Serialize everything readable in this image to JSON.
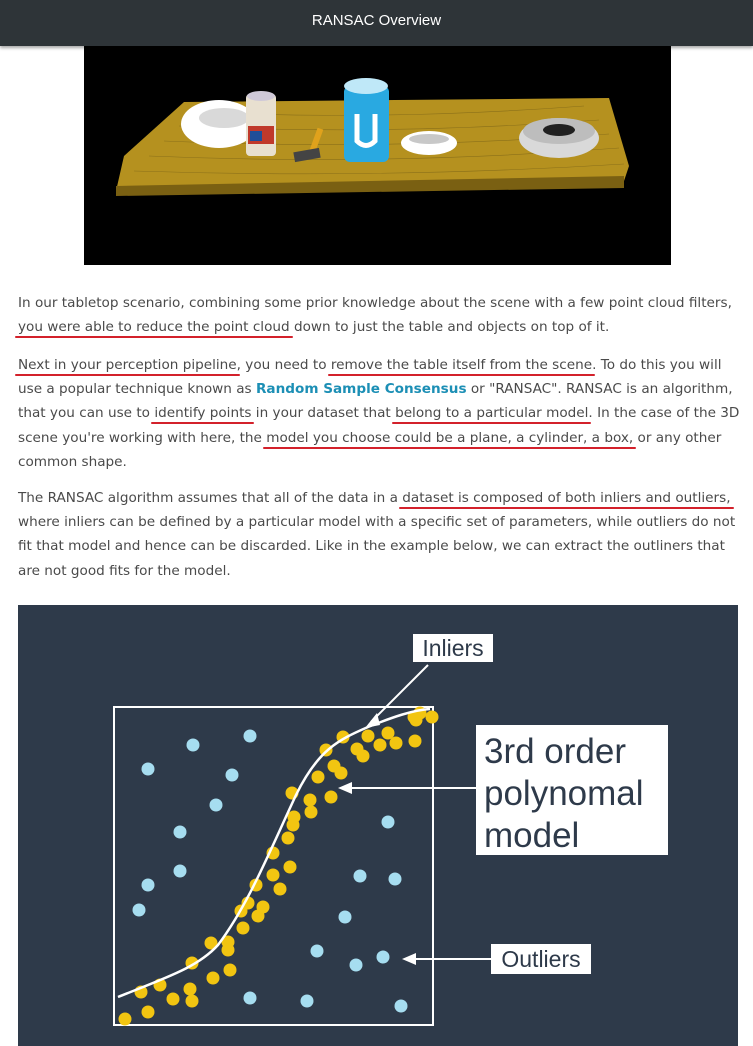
{
  "header": {
    "title": "RANSAC Overview"
  },
  "p1": {
    "a": "In our tabletop scenario, combining some prior knowledge about the scene with a few point cloud filters, ",
    "b": "you were able to reduce the point cloud",
    "c": " down to just the table and objects on top of it."
  },
  "p2": {
    "a": "Next in your perception pipeline",
    "b": ", you need to ",
    "c": "remove the table itself from the scene",
    "d": ". To do this you will use a popular technique known as ",
    "link": "Random Sample Consensus",
    "e": " or \"RANSAC\". RANSAC is an algorithm, that you can use to ",
    "f": "identify points",
    "g": " in your dataset that ",
    "h": "belong to a particular model",
    "i": ". In the case of the 3D scene you're working with here, the ",
    "j": "model you choose could be a plane, a cylinder, a box,",
    "k": " or any other common shape."
  },
  "p3": {
    "a": "The RANSAC algorithm assumes that all of the data in a ",
    "b": "dataset is composed of both inliers and outliers,",
    "c": " where inliers can be defined by a particular model with a specific set of parameters, while outliers do not fit that model and hence can be discarded. Like in the example below, we can extract the outliners that are not good fits for the model."
  },
  "diagram": {
    "inliers_label": "Inliers",
    "model_label": [
      "3rd order",
      "polynomal",
      "model"
    ],
    "outliers_label": "Outliers",
    "colors": {
      "background": "#2e3a4a",
      "inlier": "#f2c511",
      "outlier": "#a6ddf0",
      "curve": "#ffffff"
    }
  }
}
